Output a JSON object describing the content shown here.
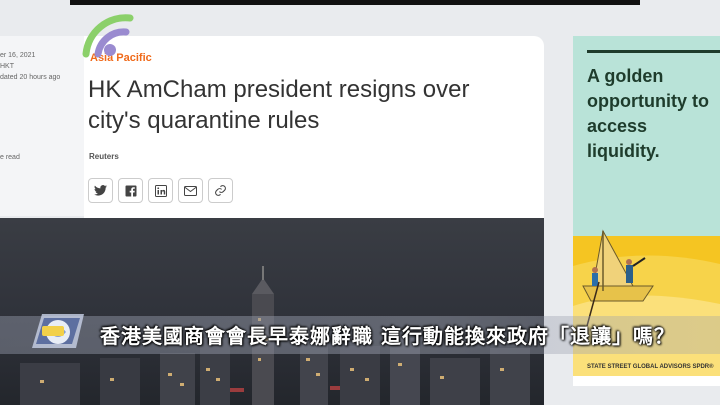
{
  "article_meta": {
    "date_line": "er 16, 2021",
    "tz_line": "HKT",
    "updated_line": "dated 20 hours ago",
    "read_line": "e read"
  },
  "article": {
    "category": "Asia Pacific",
    "headline": "HK AmCham president resigns over city's quarantine rules",
    "byline": "Reuters"
  },
  "share_icons": [
    "twitter-icon",
    "facebook-icon",
    "linkedin-icon",
    "email-icon",
    "link-icon"
  ],
  "ad": {
    "headline": "A golden opportunity to access liquidity.",
    "footer": "STATE STREET GLOBAL ADVISORS SPDR®",
    "colors": {
      "bg": "#b9e3d8",
      "text": "#1e3c2c",
      "sun": "#f5c522"
    }
  },
  "broadcast": {
    "caption": "香港美國商會會長早泰娜辭職 這行動能換來政府「退讓」嗎？",
    "channel_logo": "news-channel-logo",
    "overlay_icon": "wifi-signal-icon"
  },
  "colors": {
    "accent": "#f06a1a"
  }
}
